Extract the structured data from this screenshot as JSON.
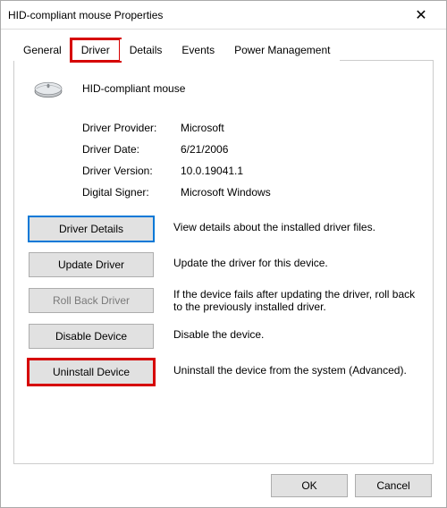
{
  "window": {
    "title": "HID-compliant mouse Properties"
  },
  "tabs": {
    "general": "General",
    "driver": "Driver",
    "details": "Details",
    "events": "Events",
    "power": "Power Management",
    "active": "driver"
  },
  "device": {
    "name": "HID-compliant mouse"
  },
  "info": {
    "provider_label": "Driver Provider:",
    "provider_value": "Microsoft",
    "date_label": "Driver Date:",
    "date_value": "6/21/2006",
    "version_label": "Driver Version:",
    "version_value": "10.0.19041.1",
    "signer_label": "Digital Signer:",
    "signer_value": "Microsoft Windows"
  },
  "actions": {
    "details_btn": "Driver Details",
    "details_desc": "View details about the installed driver files.",
    "update_btn": "Update Driver",
    "update_desc": "Update the driver for this device.",
    "rollback_btn": "Roll Back Driver",
    "rollback_desc": "If the device fails after updating the driver, roll back to the previously installed driver.",
    "disable_btn": "Disable Device",
    "disable_desc": "Disable the device.",
    "uninstall_btn": "Uninstall Device",
    "uninstall_desc": "Uninstall the device from the system (Advanced)."
  },
  "footer": {
    "ok": "OK",
    "cancel": "Cancel"
  }
}
